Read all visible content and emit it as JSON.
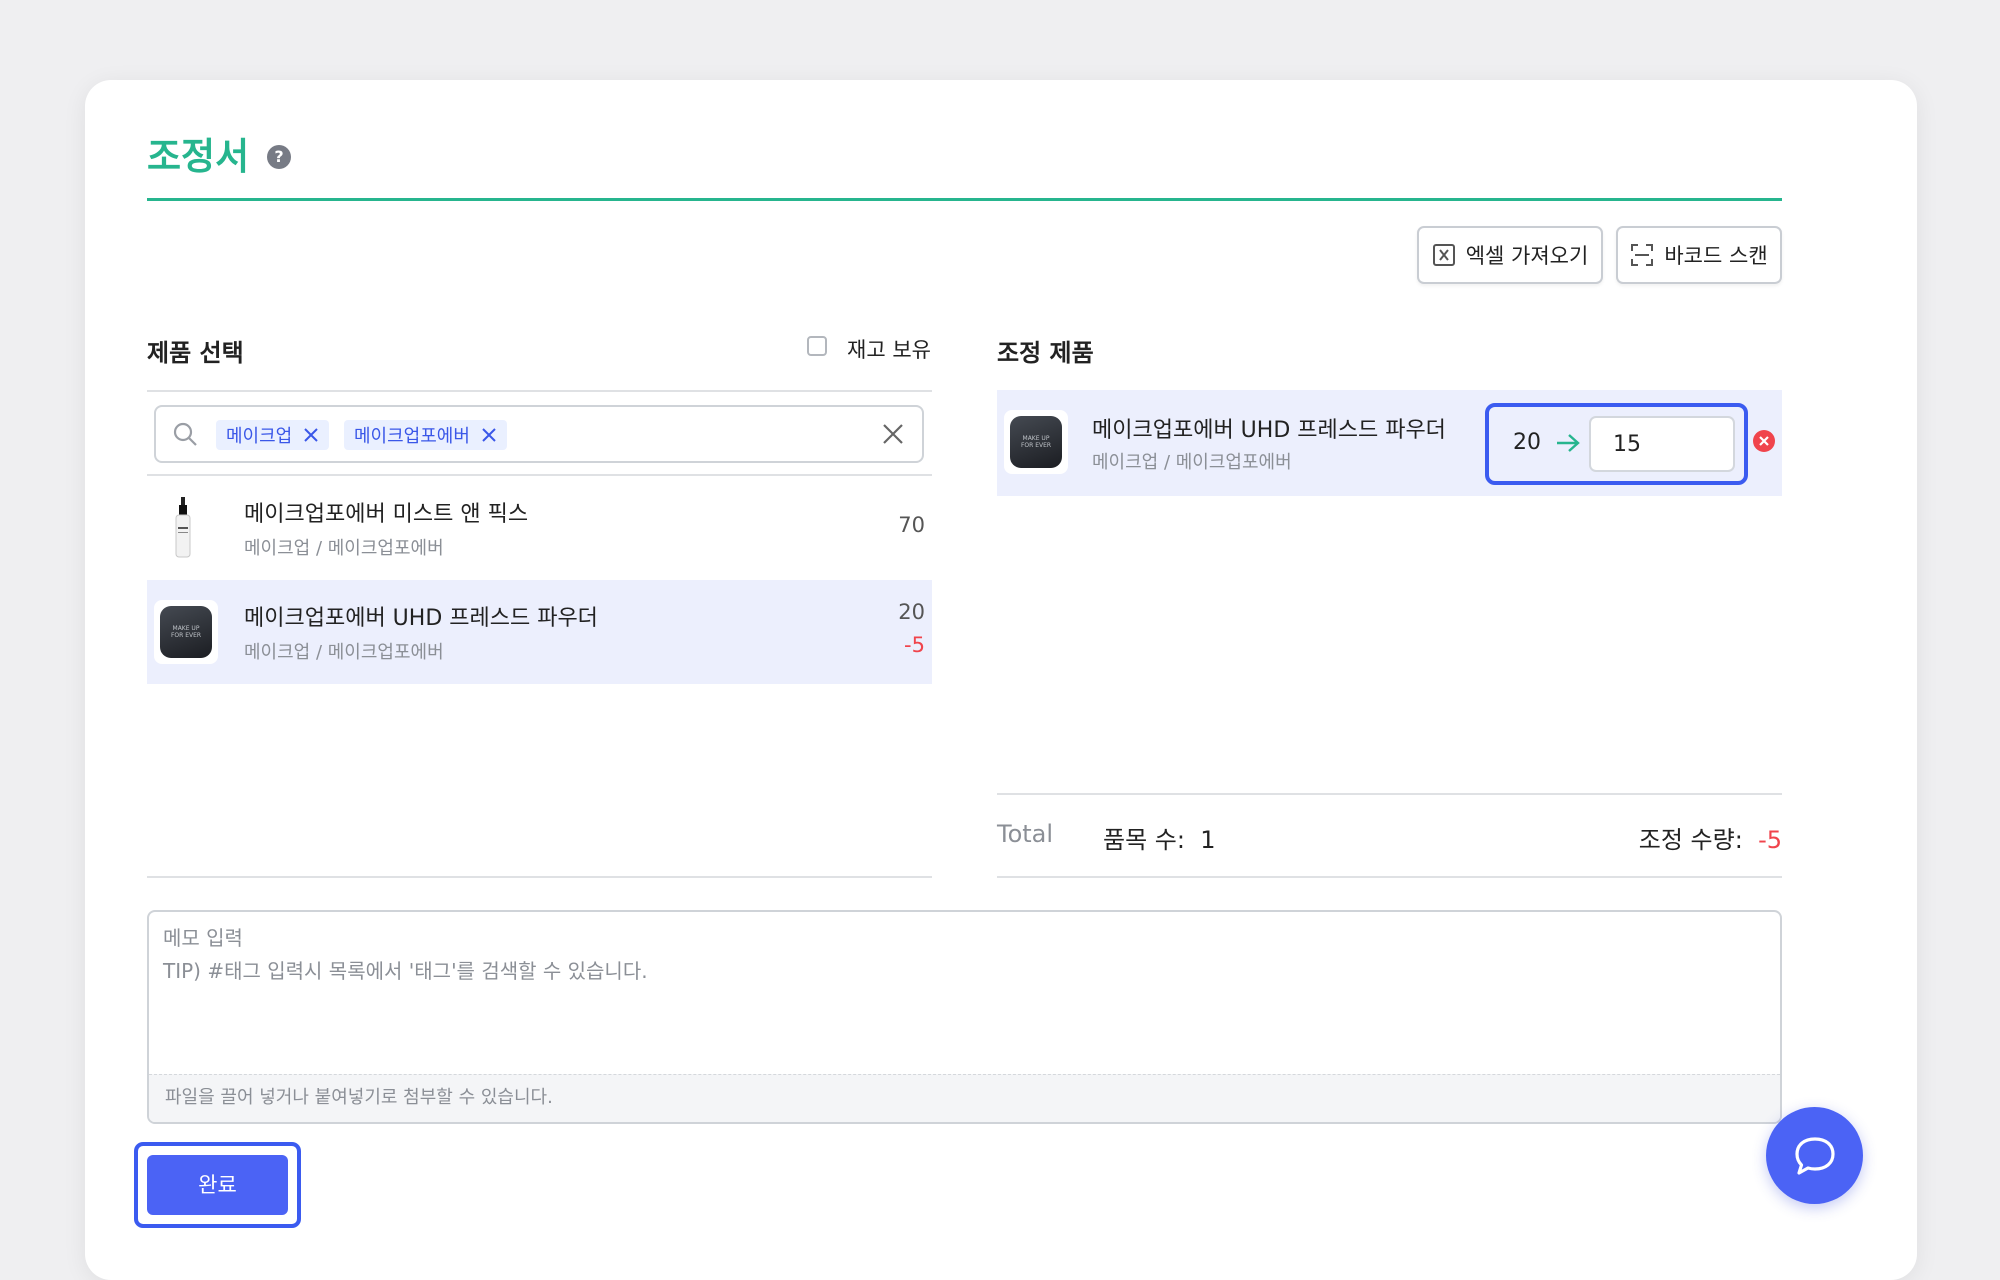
{
  "page": {
    "title": "조정서",
    "help_icon": "question-icon"
  },
  "toolbar": {
    "excel_label": "엑셀 가져오기",
    "barcode_label": "바코드 스캔"
  },
  "product_select": {
    "title": "제품 선택",
    "in_stock_label": "재고 보유",
    "in_stock_checked": false,
    "search": {
      "chips": [
        "메이크업",
        "메이크업포에버"
      ]
    },
    "items": [
      {
        "name": "메이크업포에버 미스트 앤 픽스",
        "category": "메이크업 / 메이크업포에버",
        "qty": "70",
        "selected": false
      },
      {
        "name": "메이크업포에버 UHD 프레스드 파우더",
        "category": "메이크업 / 메이크업포에버",
        "qty": "20",
        "delta": "-5",
        "selected": true
      }
    ]
  },
  "adjust_products": {
    "title": "조정 제품",
    "items": [
      {
        "name": "메이크업포에버 UHD 프레스드 파우더",
        "category": "메이크업 / 메이크업포에버",
        "from_qty": "20",
        "to_qty": "15"
      }
    ],
    "totals": {
      "label": "Total",
      "item_count_label": "품목 수:",
      "item_count": "1",
      "adjust_qty_label": "조정 수량:",
      "adjust_qty": "-5"
    }
  },
  "memo": {
    "placeholder": "메모 입력\nTIP) #태그 입력시 목록에서 '태그'를 검색할 수 있습니다.",
    "attach_hint": "파일을 끌어 넣거나 붙여넣기로 첨부할 수 있습니다."
  },
  "actions": {
    "done_label": "완료"
  },
  "colors": {
    "accent_green": "#26b58e",
    "primary_blue": "#4b63f5",
    "negative_red": "#f0444c"
  }
}
